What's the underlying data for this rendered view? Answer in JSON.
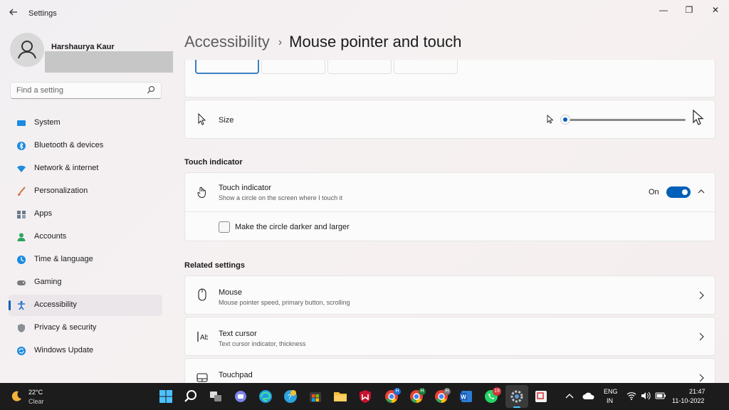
{
  "app": {
    "title": "Settings"
  },
  "window_controls": {
    "minimize": "—",
    "maximize": "❐",
    "close": "✕"
  },
  "user": {
    "name": "Harshaurya Kaur"
  },
  "search": {
    "placeholder": "Find a setting"
  },
  "sidebar": {
    "items": [
      {
        "label": "System",
        "icon": "system-icon",
        "color": "#0078d4"
      },
      {
        "label": "Bluetooth & devices",
        "icon": "bluetooth-icon",
        "color": "#0078d4"
      },
      {
        "label": "Network & internet",
        "icon": "wifi-icon",
        "color": "#0078d4"
      },
      {
        "label": "Personalization",
        "icon": "brush-icon",
        "color": "#e36a3c"
      },
      {
        "label": "Apps",
        "icon": "apps-icon",
        "color": "#5c6b7a"
      },
      {
        "label": "Accounts",
        "icon": "person-icon",
        "color": "#2ca55c"
      },
      {
        "label": "Time & language",
        "icon": "globe-clock-icon",
        "color": "#0078d4"
      },
      {
        "label": "Gaming",
        "icon": "gamepad-icon",
        "color": "#6b6b6b"
      },
      {
        "label": "Accessibility",
        "icon": "accessibility-icon",
        "color": "#0078d4",
        "active": true
      },
      {
        "label": "Privacy & security",
        "icon": "shield-icon",
        "color": "#6b6b6b"
      },
      {
        "label": "Windows Update",
        "icon": "update-icon",
        "color": "#0078d4"
      }
    ]
  },
  "breadcrumb": {
    "parent": "Accessibility",
    "separator": "›",
    "current": "Mouse pointer and touch"
  },
  "size_row": {
    "title": "Size",
    "slider_value": 0
  },
  "touch_section": {
    "header": "Touch indicator",
    "title": "Touch indicator",
    "subtitle": "Show a circle on the screen where I touch it",
    "toggle_label": "On",
    "toggle_on": true,
    "checkbox_label": "Make the circle darker and larger",
    "checkbox_checked": false
  },
  "related": {
    "header": "Related settings",
    "items": [
      {
        "title": "Mouse",
        "subtitle": "Mouse pointer speed, primary button, scrolling",
        "icon": "mouse-icon"
      },
      {
        "title": "Text cursor",
        "subtitle": "Text cursor indicator, thickness",
        "icon": "text-cursor-icon"
      },
      {
        "title": "Touchpad",
        "subtitle": "",
        "icon": "touchpad-icon"
      }
    ]
  },
  "taskbar": {
    "weather": {
      "temp": "22°C",
      "condition": "Clear"
    },
    "language": {
      "line1": "ENG",
      "line2": "IN"
    },
    "clock": {
      "time": "21:47",
      "date": "11-10-2022"
    },
    "badges": {
      "whatsapp": "19"
    }
  },
  "colors": {
    "accent": "#005fb8",
    "taskbar": "#1c1c1c"
  }
}
